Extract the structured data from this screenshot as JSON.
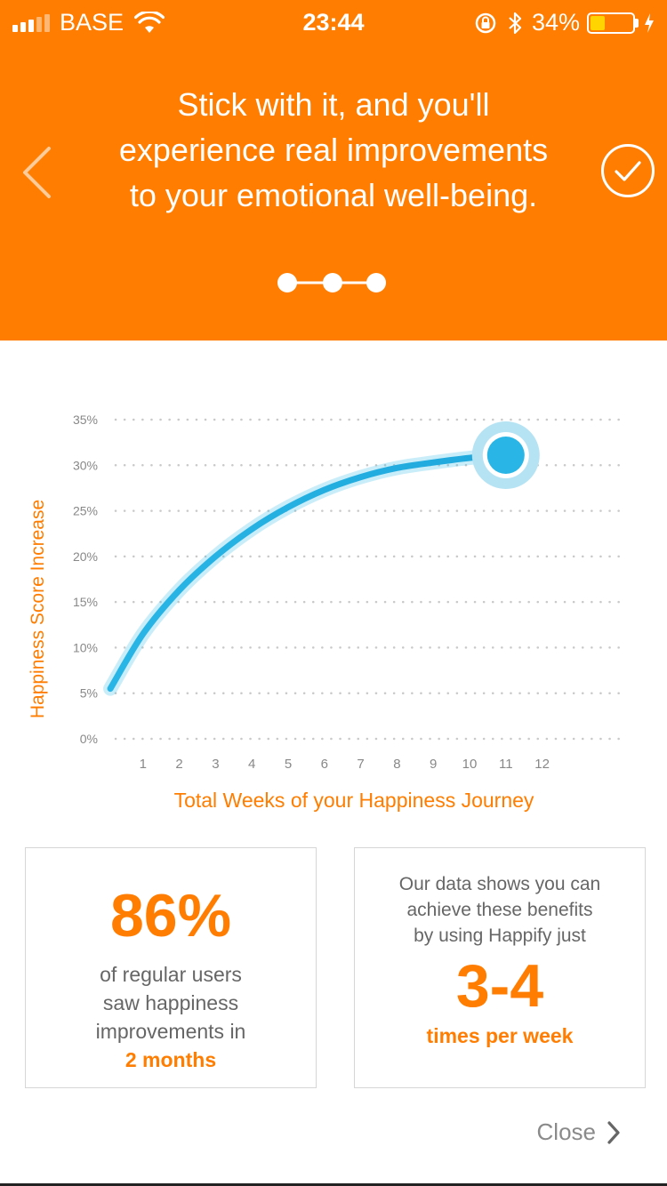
{
  "status_bar": {
    "carrier": "BASE",
    "time": "23:44",
    "battery_percent": "34%",
    "battery_level": 0.34,
    "icons": [
      "signal-icon",
      "wifi-icon",
      "rotation-lock-icon",
      "bluetooth-icon",
      "battery-icon",
      "charging-icon"
    ]
  },
  "header": {
    "line1": "Stick with it, and you'll",
    "line2": "experience real improvements",
    "line3": "to your emotional well-being.",
    "back_icon": "chevron-left-icon",
    "done_icon": "checkmark-circle-icon",
    "pager_steps": 3,
    "pager_active": 3
  },
  "chart_data": {
    "type": "line",
    "ylabel": "Happiness Score Increase",
    "xlabel": "Total Weeks of your Happiness Journey",
    "y_ticks": [
      "35%",
      "30%",
      "25%",
      "20%",
      "15%",
      "10%",
      "5%",
      "0%"
    ],
    "x_ticks": [
      "1",
      "2",
      "3",
      "4",
      "5",
      "6",
      "7",
      "8",
      "9",
      "10",
      "11",
      "12"
    ],
    "ylim": [
      0,
      35
    ],
    "xlim": [
      0,
      12
    ],
    "grid": true,
    "series": [
      {
        "x": [
          0.1,
          1,
          2,
          3,
          4,
          5,
          6,
          7,
          8,
          9,
          10,
          11
        ],
        "y": [
          5.5,
          11.5,
          16.3,
          20,
          23,
          25.4,
          27.3,
          28.7,
          29.7,
          30.3,
          30.8,
          31.1
        ]
      }
    ],
    "endpoint": {
      "x": 11,
      "y": 31.1
    },
    "line_color": "#29b6e6",
    "axis_label_color": "#ff7d00"
  },
  "stats": {
    "left": {
      "big": "86%",
      "line1": "of regular users",
      "line2": "saw happiness",
      "line3": "improvements in",
      "accent": "2 months"
    },
    "right": {
      "line1": "Our data shows you can",
      "line2": "achieve these benefits",
      "line3": "by using Happify just",
      "big": "3-4",
      "accent": "times per week"
    }
  },
  "footer": {
    "close_label": "Close",
    "close_icon": "chevron-right-icon"
  },
  "colors": {
    "brand_orange": "#ff7d00",
    "chart_blue": "#29b6e6",
    "text_gray": "#666666"
  }
}
